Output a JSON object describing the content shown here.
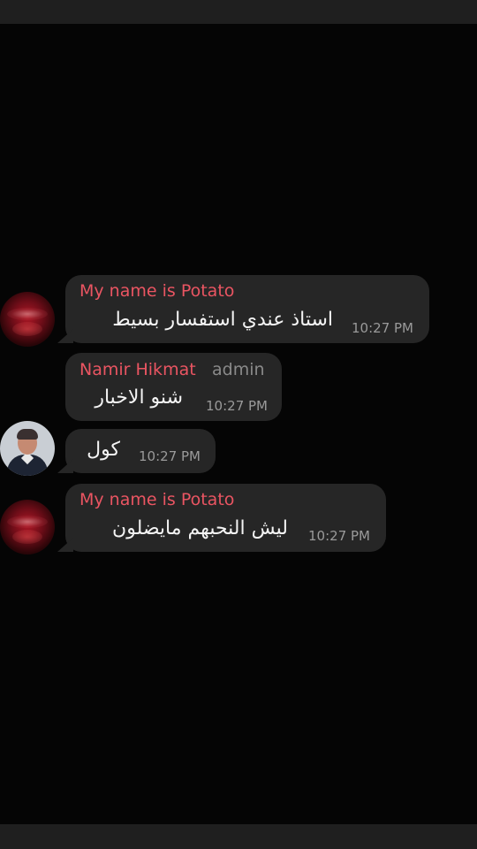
{
  "colors": {
    "background": "#050505",
    "bubble": "#262626",
    "sender_name": "#ea5562",
    "role": "#8a8a8a",
    "message_text": "#f4f4f4",
    "timestamp": "#9a9a9a"
  },
  "messages": [
    {
      "sender": "My name is Potato",
      "text": "استاذ عندي استفسار بسيط",
      "time": "10:27 PM",
      "avatar_icon": "red-abstract-avatar"
    },
    {
      "sender": "Namir Hikmat",
      "role": "admin",
      "text": "شنو الاخبار",
      "time": "10:27 PM"
    },
    {
      "text": "كول",
      "time": "10:27 PM",
      "avatar_icon": "person-photo-avatar"
    },
    {
      "sender": "My name is Potato",
      "text": "ليش النحبهم مايضلون",
      "time": "10:27 PM",
      "avatar_icon": "red-abstract-avatar"
    }
  ]
}
